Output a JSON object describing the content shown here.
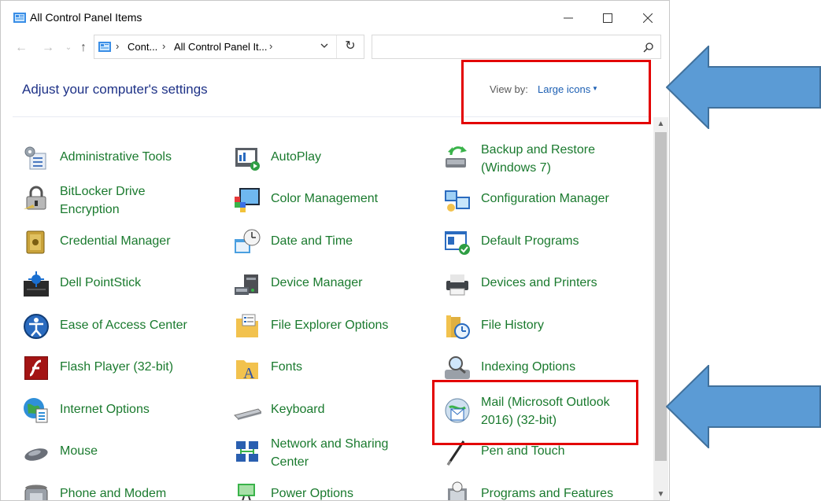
{
  "window": {
    "title": "All Control Panel Items"
  },
  "address": {
    "crumbs": [
      "Cont...",
      "All Control Panel It..."
    ]
  },
  "search": {
    "placeholder": ""
  },
  "header": {
    "heading": "Adjust your computer's settings",
    "view_by_label": "View by:",
    "view_by_value": "Large icons"
  },
  "items": {
    "col1": [
      {
        "label": "Administrative Tools",
        "icon": "administrative-tools-icon"
      },
      {
        "label": "BitLocker Drive\nEncryption",
        "icon": "bitlocker-icon"
      },
      {
        "label": "Credential Manager",
        "icon": "credential-manager-icon"
      },
      {
        "label": "Dell PointStick",
        "icon": "dell-pointstick-icon"
      },
      {
        "label": "Ease of Access Center",
        "icon": "ease-of-access-icon"
      },
      {
        "label": "Flash Player (32-bit)",
        "icon": "flash-player-icon"
      },
      {
        "label": "Internet Options",
        "icon": "internet-options-icon"
      },
      {
        "label": "Mouse",
        "icon": "mouse-icon"
      },
      {
        "label": "Phone and Modem",
        "icon": "phone-modem-icon"
      }
    ],
    "col2": [
      {
        "label": "AutoPlay",
        "icon": "autoplay-icon"
      },
      {
        "label": "Color Management",
        "icon": "color-management-icon"
      },
      {
        "label": "Date and Time",
        "icon": "date-time-icon"
      },
      {
        "label": "Device Manager",
        "icon": "device-manager-icon"
      },
      {
        "label": "File Explorer Options",
        "icon": "file-explorer-options-icon"
      },
      {
        "label": "Fonts",
        "icon": "fonts-icon"
      },
      {
        "label": "Keyboard",
        "icon": "keyboard-icon"
      },
      {
        "label": "Network and Sharing\nCenter",
        "icon": "network-sharing-icon"
      },
      {
        "label": "Power Options",
        "icon": "power-options-icon"
      }
    ],
    "col3": [
      {
        "label": "Backup and Restore\n(Windows 7)",
        "icon": "backup-restore-icon"
      },
      {
        "label": "Configuration Manager",
        "icon": "configuration-manager-icon"
      },
      {
        "label": "Default Programs",
        "icon": "default-programs-icon"
      },
      {
        "label": "Devices and Printers",
        "icon": "devices-printers-icon"
      },
      {
        "label": "File History",
        "icon": "file-history-icon"
      },
      {
        "label": "Indexing Options",
        "icon": "indexing-options-icon"
      },
      {
        "label": "Mail (Microsoft Outlook\n2016) (32-bit)",
        "icon": "mail-icon"
      },
      {
        "label": "Pen and Touch",
        "icon": "pen-touch-icon"
      },
      {
        "label": "Programs and Features",
        "icon": "programs-features-icon"
      }
    ]
  },
  "colors": {
    "heading": "#1e3287",
    "item_label": "#1a7a2e",
    "link": "#1c5fb3",
    "highlight": "#e30000",
    "arrow": "#5b9bd5"
  }
}
